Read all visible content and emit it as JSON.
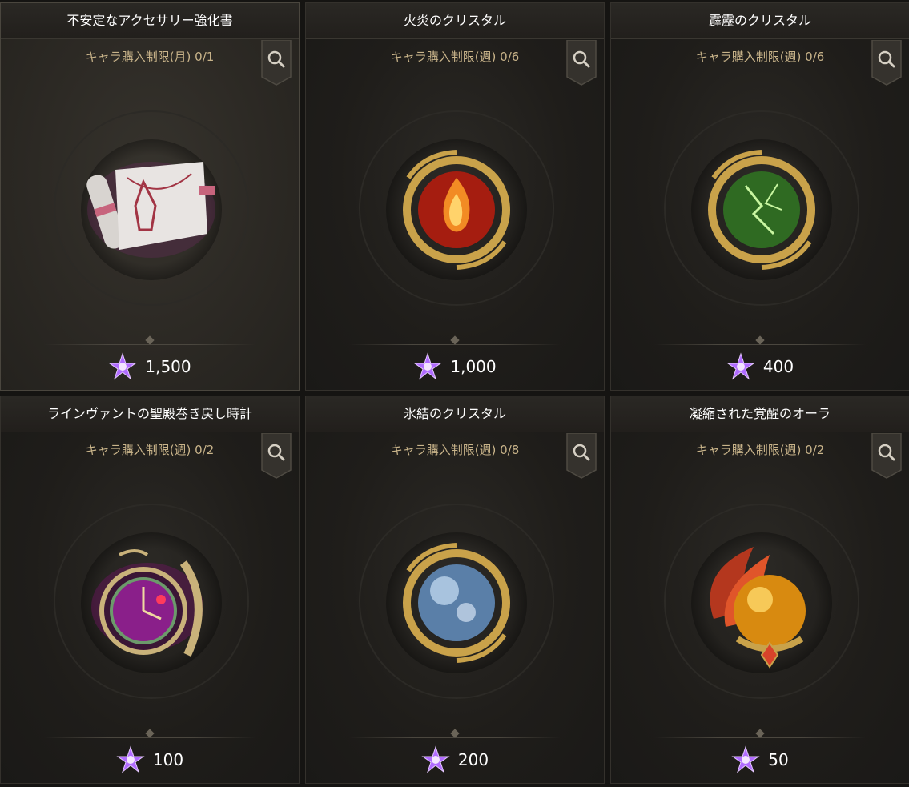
{
  "items": [
    {
      "name": "不安定なアクセサリー強化書",
      "limit": "キャラ購入制限(月) 0/1",
      "price": "1,500",
      "icon": "scroll-icon"
    },
    {
      "name": "火炎のクリスタル",
      "limit": "キャラ購入制限(週) 0/6",
      "price": "1,000",
      "icon": "fire-crystal-icon"
    },
    {
      "name": "霹靂のクリスタル",
      "limit": "キャラ購入制限(週) 0/6",
      "price": "400",
      "icon": "lightning-crystal-icon"
    },
    {
      "name": "ラインヴァントの聖殿巻き戻し時計",
      "limit": "キャラ購入制限(週) 0/2",
      "price": "100",
      "icon": "clock-icon"
    },
    {
      "name": "氷結のクリスタル",
      "limit": "キャラ購入制限(週) 0/8",
      "price": "200",
      "icon": "ice-crystal-icon"
    },
    {
      "name": "凝縮された覚醒のオーラ",
      "limit": "キャラ購入制限(週) 0/2",
      "price": "50",
      "icon": "aura-orb-icon"
    }
  ],
  "currency_icon": "purple-star-gem-icon",
  "colors": {
    "title": "#ffffff",
    "limit": "#c9b48a",
    "price": "#ffffff",
    "card_bg": "#1f1d1a",
    "accent_gold": "#c9a24a"
  }
}
